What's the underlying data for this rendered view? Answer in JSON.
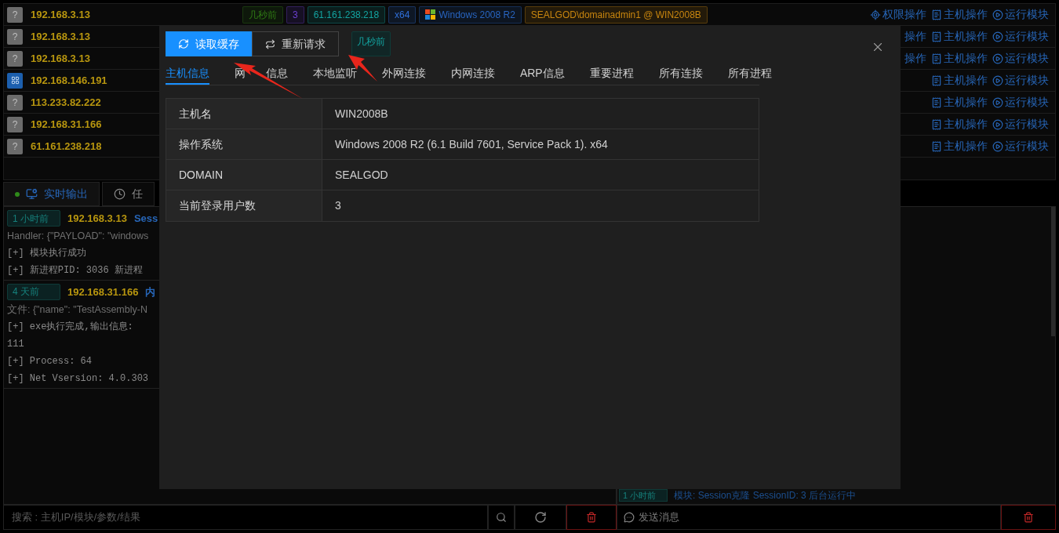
{
  "hosts": [
    {
      "ip": "192.168.3.13",
      "icon": {
        "kind": "unknown",
        "glyph": "?"
      },
      "tags": [
        {
          "text": "几秒前",
          "color": "#2f7a14"
        },
        {
          "text": "3",
          "color": "#6b3fd0"
        },
        {
          "text": "61.161.238.218",
          "color": "#13a3a0"
        },
        {
          "text": "x64",
          "color": "#2f6fd8"
        },
        {
          "text": "Windows 2008 R2",
          "color": "#2864bf",
          "kind": "os"
        },
        {
          "text": "SEALGOD\\domainadmin1 @ WIN2008B",
          "color": "#c7850f"
        }
      ],
      "actions": [
        {
          "kind": "privilege",
          "label": "权限操作"
        },
        {
          "kind": "host",
          "label": "主机操作"
        },
        {
          "kind": "module",
          "label": "运行模块"
        }
      ]
    },
    {
      "ip": "192.168.3.13",
      "icon": {
        "kind": "unknown",
        "glyph": "?"
      },
      "actions": [
        {
          "kind": "partial",
          "label": "操作"
        },
        {
          "kind": "host",
          "label": "主机操作"
        },
        {
          "kind": "module",
          "label": "运行模块"
        }
      ]
    },
    {
      "ip": "192.168.3.13",
      "icon": {
        "kind": "unknown",
        "glyph": "?"
      },
      "actions": [
        {
          "kind": "partial",
          "label": "操作"
        },
        {
          "kind": "host",
          "label": "主机操作"
        },
        {
          "kind": "module",
          "label": "运行模块"
        }
      ]
    },
    {
      "ip": "192.168.146.191",
      "icon": {
        "kind": "app"
      },
      "actions": [
        {
          "kind": "host",
          "label": "主机操作"
        },
        {
          "kind": "module",
          "label": "运行模块"
        }
      ]
    },
    {
      "ip": "113.233.82.222",
      "icon": {
        "kind": "unknown",
        "glyph": "?"
      },
      "actions": [
        {
          "kind": "host",
          "label": "主机操作"
        },
        {
          "kind": "module",
          "label": "运行模块"
        }
      ]
    },
    {
      "ip": "192.168.31.166",
      "icon": {
        "kind": "unknown",
        "glyph": "?"
      },
      "actions": [
        {
          "kind": "host",
          "label": "主机操作"
        },
        {
          "kind": "module",
          "label": "运行模块"
        }
      ]
    },
    {
      "ip": "61.161.238.218",
      "icon": {
        "kind": "unknown",
        "glyph": "?"
      },
      "actions": [
        {
          "kind": "host",
          "label": "主机操作"
        },
        {
          "kind": "module",
          "label": "运行模块"
        }
      ]
    }
  ],
  "console": {
    "tabs": [
      {
        "label": "实时输出",
        "kind": "live",
        "selected": true
      },
      {
        "label": "任",
        "kind": "clock",
        "selected": false
      }
    ],
    "entries": [
      {
        "time": "1 小时前",
        "ip": "192.168.3.13",
        "title": "Sess",
        "detail": "Handler: {\"PAYLOAD\": \"windows",
        "lines": [
          "[+] 模块执行成功",
          "[+] 新进程PID: 3036 新进程"
        ]
      },
      {
        "time": "4 天前",
        "ip": "192.168.31.166",
        "title": "内",
        "detail": "文件: {\"name\": \"TestAssembly-N",
        "lines": [
          "[+] exe执行完成,输出信息:",
          "111",
          "[+] Process: 64",
          "[+] Net Vsersion: 4.0.303"
        ]
      }
    ],
    "side_entry": {
      "time": "1 小时前",
      "text": "模块: Session克隆 SessionID: 3 后台运行中"
    }
  },
  "footer": {
    "search_placeholder": "搜索 : 主机IP/模块/参数/结果",
    "message_placeholder": "发送消息"
  },
  "modal": {
    "buttons": [
      {
        "label": "读取缓存",
        "kind": "primary"
      },
      {
        "label": "重新请求",
        "kind": "default"
      }
    ],
    "timestamp": "几秒前",
    "tabs": [
      {
        "label": "主机信息",
        "selected": true
      },
      {
        "label": "网 信息",
        "selected": false
      },
      {
        "label": "本地监听",
        "selected": false
      },
      {
        "label": "外网连接",
        "selected": false
      },
      {
        "label": "内网连接",
        "selected": false
      },
      {
        "label": "ARP信息",
        "selected": false
      },
      {
        "label": "重要进程",
        "selected": false
      },
      {
        "label": "所有连接",
        "selected": false
      },
      {
        "label": "所有进程",
        "selected": false
      }
    ],
    "rows": [
      {
        "label": "主机名",
        "value": "WIN2008B"
      },
      {
        "label": "操作系统",
        "value": "Windows 2008 R2 (6.1 Build 7601, Service Pack 1). x64"
      },
      {
        "label": "DOMAIN",
        "value": "SEALGOD"
      },
      {
        "label": "当前登录用户数",
        "value": "3"
      }
    ]
  }
}
